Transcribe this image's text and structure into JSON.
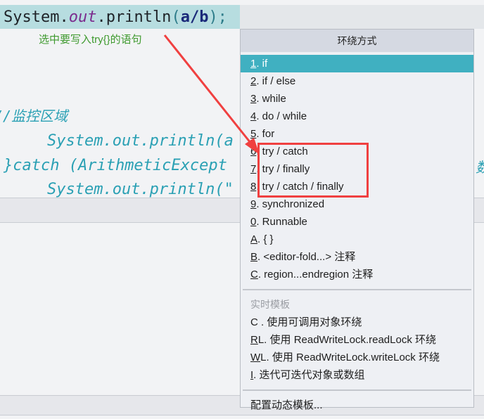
{
  "editor": {
    "selected_line": {
      "prefix": "System.",
      "out": "out",
      "middle": ".println",
      "open_paren": "(",
      "a": "a",
      "slash": "/",
      "b": "b",
      "close": ");"
    },
    "annotation": "选中要写入try{}的语句",
    "lines": [
      "//监控区域",
      "    System.out.println(a",
      "}catch (ArithmeticExcept",
      "    System.out.println(\""
    ],
    "right_cut_text": "数"
  },
  "popup": {
    "title": "环绕方式",
    "items": [
      {
        "mnemonic": "1",
        "label": ". if",
        "selected": true
      },
      {
        "mnemonic": "2",
        "label": ". if / else"
      },
      {
        "mnemonic": "3",
        "label": ". while"
      },
      {
        "mnemonic": "4",
        "label": ". do / while"
      },
      {
        "mnemonic": "5",
        "label": ". for"
      },
      {
        "mnemonic": "6",
        "label": ". try / catch"
      },
      {
        "mnemonic": "7",
        "label": ". try / finally"
      },
      {
        "mnemonic": "8",
        "label": ". try / catch / finally"
      },
      {
        "mnemonic": "9",
        "label": ". synchronized"
      },
      {
        "mnemonic": "0",
        "label": ". Runnable"
      },
      {
        "mnemonic": "A",
        "label": ". { }"
      },
      {
        "mnemonic": "B",
        "label": ". <editor-fold...> 注释"
      },
      {
        "mnemonic": "C",
        "label": ". region...endregion 注释"
      }
    ],
    "live_templates_label": "实时模板",
    "live_templates": [
      {
        "mnemonic": "",
        "label": "C . 使用可调用对象环绕"
      },
      {
        "mnemonic": "R",
        "label": "L. 使用 ReadWriteLock.readLock 环绕"
      },
      {
        "mnemonic": "W",
        "label": "L. 使用 ReadWriteLock.writeLock 环绕"
      },
      {
        "mnemonic": "I",
        "label": ". 迭代可迭代对象或数组"
      }
    ],
    "configure_label": "配置动态模板..."
  },
  "colors": {
    "selection_highlight": "#40b0c1",
    "annotation_red": "#f04040",
    "annotation_green": "#3f9a2f"
  }
}
